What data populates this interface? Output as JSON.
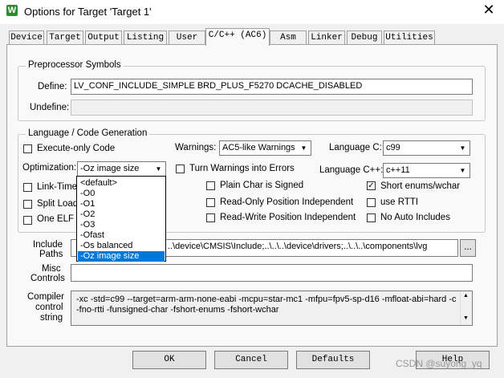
{
  "window": {
    "title": "Options for Target 'Target 1'",
    "close": "✕",
    "app_icon": "W"
  },
  "tabs": [
    "Device",
    "Target",
    "Output",
    "Listing",
    "User",
    "C/C++ (AC6)",
    "Asm",
    "Linker",
    "Debug",
    "Utilities"
  ],
  "preprocessor": {
    "group_label": "Preprocessor Symbols",
    "define_label": "Define:",
    "define_value": "LV_CONF_INCLUDE_SIMPLE BRD_PLUS_F5270 DCACHE_DISABLED",
    "undefine_label": "Undefine:",
    "undefine_value": ""
  },
  "language": {
    "group_label": "Language / Code Generation",
    "execute_only": "Execute-only Code",
    "optimization_label": "Optimization:",
    "optimization_value": "-Oz image size",
    "link_time": "Link-Time O",
    "split_load": "Split Load a",
    "one_elf": "One ELF S",
    "warnings_label": "Warnings:",
    "warnings_value": "AC5-like Warnings",
    "turn_warnings": "Turn Warnings into Errors",
    "plain_char": "Plain Char is Signed",
    "ro_pos": "Read-Only Position Independent",
    "rw_pos": "Read-Write Position Independent",
    "lang_c_label": "Language C:",
    "lang_c_value": "c99",
    "lang_cpp_label": "Language C++:",
    "lang_cpp_value": "c++11",
    "short_enums": "Short enums/wchar",
    "use_rtti": "use RTTI",
    "no_auto_includes": "No Auto Includes",
    "checks": {
      "execute_only": false,
      "link_time": false,
      "split_load": false,
      "one_elf": false,
      "turn_warnings": false,
      "plain_char": false,
      "ro_pos": false,
      "rw_pos": false,
      "short_enums": true,
      "use_rtti": false,
      "no_auto_includes": false
    }
  },
  "optimization_options": [
    "<default>",
    "-O0",
    "-O1",
    "-O2",
    "-O3",
    "-Ofast",
    "-Os balanced",
    "-Oz image size"
  ],
  "include_paths": {
    "label_1": "Include",
    "label_2": "Paths",
    "value": "..\\device\\CMSIS\\Include;..\\..\\..\\device\\drivers;..\\..\\..\\components\\lvg",
    "browse": "..."
  },
  "misc": {
    "label_1": "Misc",
    "label_2": "Controls",
    "value": ""
  },
  "compiler": {
    "label_1": "Compiler",
    "label_2": "control",
    "label_3": "string",
    "line1": "-xc -std=c99 --target=arm-arm-none-eabi -mcpu=star-mc1 -mfpu=fpv5-sp-d16 -mfloat-abi=hard -c",
    "line2": "-fno-rtti -funsigned-char -fshort-enums -fshort-wchar"
  },
  "buttons": {
    "ok": "OK",
    "cancel": "Cancel",
    "defaults": "Defaults",
    "help": "Help"
  },
  "watermark": "CSDN @suyong_yq"
}
